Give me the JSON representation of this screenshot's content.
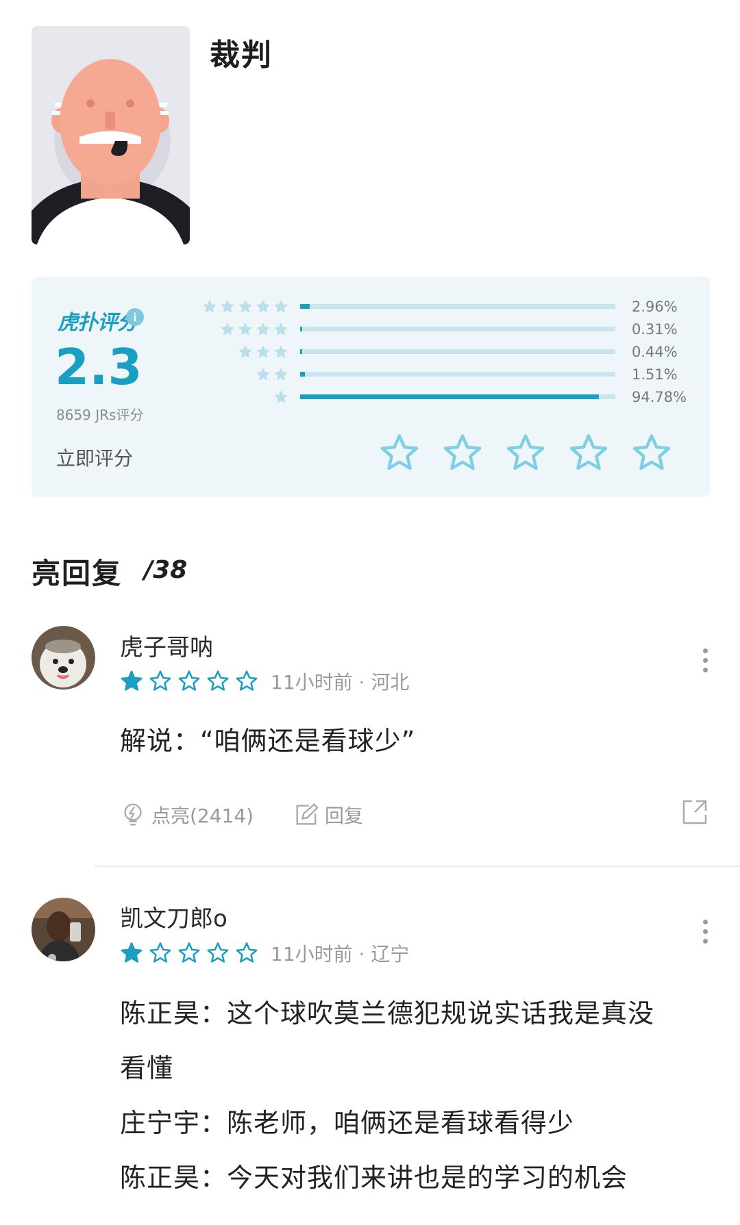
{
  "header": {
    "title": "裁判",
    "avatar_icon": "referee-avatar"
  },
  "rating": {
    "brand": "虎扑评分",
    "score": "2.3",
    "count_text": "8659 JRs评分",
    "rate_now_label": "立即评分",
    "accent_color": "#1a9ec2",
    "distribution": [
      {
        "stars": 5,
        "percent_text": "2.96%",
        "fraction": 0.0296
      },
      {
        "stars": 4,
        "percent_text": "0.31%",
        "fraction": 0.0031
      },
      {
        "stars": 3,
        "percent_text": "0.44%",
        "fraction": 0.0044
      },
      {
        "stars": 2,
        "percent_text": "1.51%",
        "fraction": 0.0151
      },
      {
        "stars": 1,
        "percent_text": "94.78%",
        "fraction": 0.9478
      }
    ],
    "rate_input_stars": 5
  },
  "replies": {
    "title": "亮回复",
    "count": "/38"
  },
  "comments": [
    {
      "username": "虎子哥呐",
      "avatar": "dog-avatar",
      "stars": 1,
      "meta": "11小时前 · 河北",
      "lines": [
        "解说：“咱俩还是看球少”"
      ],
      "like_label": "点亮(2414)",
      "reply_label": "回复",
      "share_icon": "share-icon"
    },
    {
      "username": "凯文刀郎o",
      "avatar": "player-avatar",
      "stars": 1,
      "meta": "11小时前 · 辽宁",
      "lines": [
        "陈正昊：这个球吹莫兰德犯规说实话我是真没",
        "看懂",
        "庄宁宇：陈老师，咱俩还是看球看得少",
        "陈正昊：今天对我们来讲也是的学习的机会"
      ]
    }
  ]
}
